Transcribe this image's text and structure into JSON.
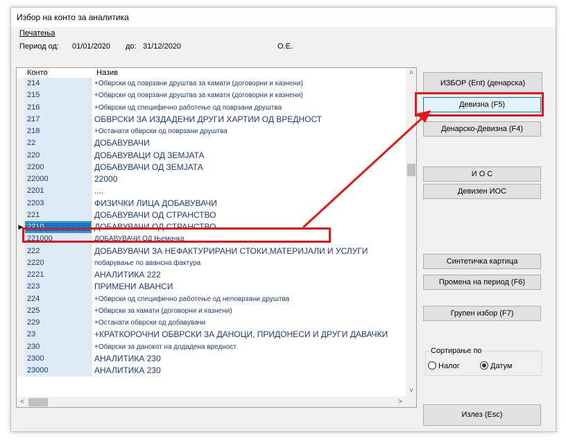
{
  "window": {
    "title": "Избор на конто за аналитика"
  },
  "menu": {
    "print": "Печатења"
  },
  "period": {
    "from_label": "Период од:",
    "from_value": "01/01/2020",
    "to_label": "до:",
    "to_value": "31/12/2020",
    "company": "О.Е."
  },
  "grid": {
    "columns": [
      "Конто",
      "Назив"
    ],
    "rows": [
      {
        "code": "214",
        "name": "+Обврски од поврзани друштва за камати (договорни и казнени)"
      },
      {
        "code": "215",
        "name": "+Обврски од поврзани друштва за камати (договорни и казнени)"
      },
      {
        "code": "216",
        "name": "+Обврски од специфично работење од поврзани друштва"
      },
      {
        "code": "217",
        "name": "ОБВРСКИ ЗА ИЗДАДЕНИ ДРУГИ ХАРТИИ ОД ВРЕДНОСТ"
      },
      {
        "code": "218",
        "name": "+Останати обврски од поврзани друштва"
      },
      {
        "code": "22",
        "name": "ДОБАВУВАЧИ"
      },
      {
        "code": "220",
        "name": "ДОБАВУВАЦИ ОД ЗЕМЈАТА"
      },
      {
        "code": "2200",
        "name": "ДОБАВУВАЧИ ОД ЗЕМЈАТА"
      },
      {
        "code": "22000",
        "name": "22000"
      },
      {
        "code": "2201",
        "name": "...."
      },
      {
        "code": "2203",
        "name": "ФИЗИЧКИ ЛИЦА ДОБАВУВАЧИ"
      },
      {
        "code": "221",
        "name": "ДОБАВУВАЧИ ОД СТРАНСТВО"
      },
      {
        "code": "2210",
        "name": "ДОБАВУВАЧИ ОД СТРАНСТВО"
      },
      {
        "code": "221000",
        "name": "ДОБАВУВАЧИ ОД Њемачка"
      },
      {
        "code": "222",
        "name": "ДОБАВУВАЧИ ЗА НЕФАКТУРИРАНИ СТОКИ,МАТЕРИЈАЛИ И УСЛУГИ"
      },
      {
        "code": "2220",
        "name": "побарување по авансна фактура"
      },
      {
        "code": "2221",
        "name": "АНАЛИТИКА 222"
      },
      {
        "code": "223",
        "name": "ПРИМЕНИ АВАНСИ"
      },
      {
        "code": "224",
        "name": "+Обврски од специфично работење од неповрзани друштва"
      },
      {
        "code": "225",
        "name": "+Обврски за камати (договорни и казнени)"
      },
      {
        "code": "229",
        "name": "+Останати обврски од добавувачи"
      },
      {
        "code": "23",
        "name": "+КРАТКОРОЧНИ ОБВРСКИ ЗА ДАНОЦИ, ПРИДОНЕСИ И ДРУГИ ДАВАЧКИ"
      },
      {
        "code": "230",
        "name": "+Обврски за данокот на додадена вредност"
      },
      {
        "code": "2300",
        "name": "АНАЛИТИКА 230"
      },
      {
        "code": "23000",
        "name": "АНАЛИТИКА 230"
      }
    ],
    "selected_row_index": 12,
    "current_row_marker": "▶"
  },
  "buttons": {
    "izbor": "ИЗБОР (Ent) (денарска)",
    "devizna": "Девизна (F5)",
    "denarsko_devizna": "Денарско-Девизна (F4)",
    "ios": "И О С",
    "deviz_ios": "Девизен ИОС",
    "sintetichka": "Синтетичка картица",
    "promena": "Промена на период (F6)",
    "grupen": "Групен избор (F7)",
    "izlez": "Излез (Esc)"
  },
  "sort": {
    "label": "Сортирање по",
    "options": [
      "Налог",
      "Датум"
    ],
    "selected": "Датум"
  },
  "annotation_color": "#e8141a"
}
